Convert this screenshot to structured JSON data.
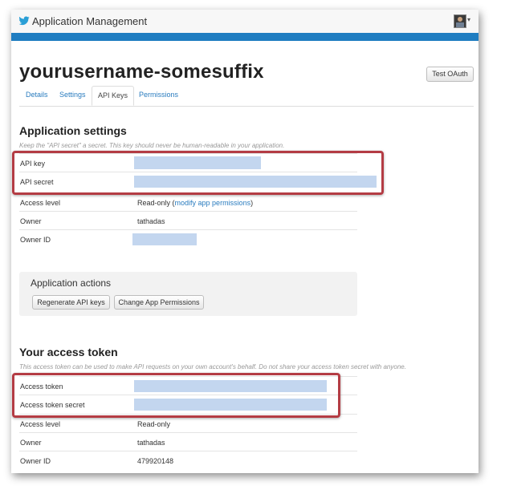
{
  "header": {
    "app_title": "Application Management",
    "avatar_caret": "▾"
  },
  "page": {
    "title": "yourusername-somesuffix",
    "test_oauth_label": "Test OAuth"
  },
  "tabs": [
    {
      "label": "Details",
      "active": false
    },
    {
      "label": "Settings",
      "active": false
    },
    {
      "label": "API Keys",
      "active": true
    },
    {
      "label": "Permissions",
      "active": false
    }
  ],
  "app_settings": {
    "title": "Application settings",
    "note": "Keep the \"API secret\" a secret. This key should never be human-readable in your application.",
    "rows": {
      "api_key": {
        "label": "API key"
      },
      "api_secret": {
        "label": "API secret"
      },
      "access_level": {
        "label": "Access level",
        "value": "Read-only (",
        "link": "modify app permissions",
        "suffix": ")"
      },
      "owner": {
        "label": "Owner",
        "value": "tathadas"
      },
      "owner_id": {
        "label": "Owner ID"
      }
    }
  },
  "app_actions": {
    "title": "Application actions",
    "regenerate_label": "Regenerate API keys",
    "change_permissions_label": "Change App Permissions"
  },
  "access_token": {
    "title": "Your access token",
    "note": "This access token can be used to make API requests on your own account's behalf. Do not share your access token secret with anyone.",
    "rows": {
      "token": {
        "label": "Access token"
      },
      "token_secret": {
        "label": "Access token secret"
      },
      "access_level": {
        "label": "Access level",
        "value": "Read-only"
      },
      "owner": {
        "label": "Owner",
        "value": "tathadas"
      },
      "owner_id": {
        "label": "Owner ID",
        "value": "479920148"
      }
    }
  },
  "colors": {
    "header_bar": "#1f7dc1",
    "link": "#2a7cbf",
    "highlight_box": "#b43c44",
    "redaction": "#c3d6ef"
  },
  "icons": {
    "logo": "twitter-bird-icon",
    "avatar": "user-avatar"
  }
}
